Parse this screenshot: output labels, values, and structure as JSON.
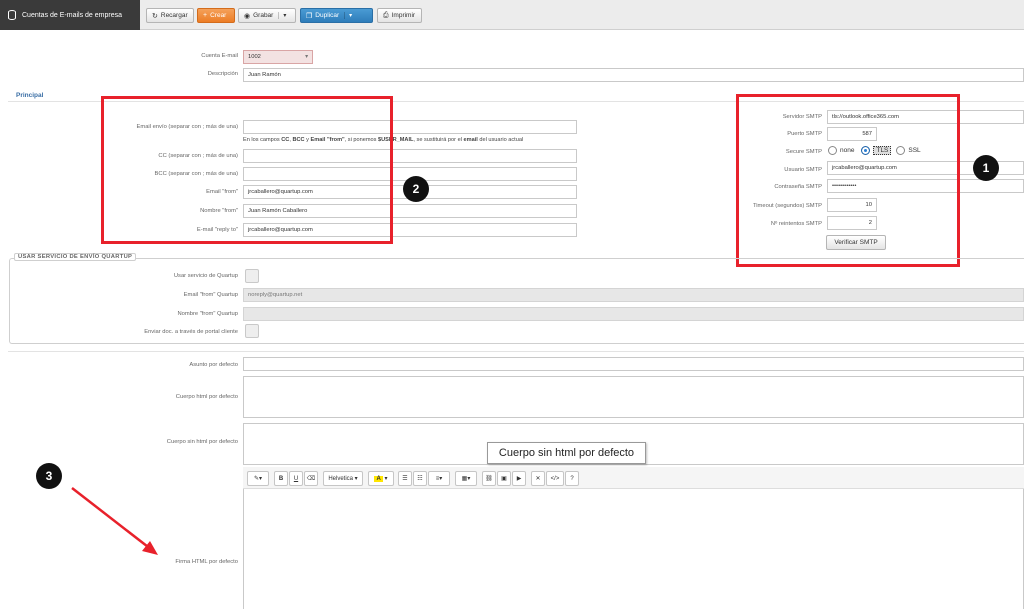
{
  "window_title": "Cuentas de E-mails de empresa",
  "toolbar": {
    "reload": "Recargar",
    "create": "Crear",
    "save": "Grabar",
    "duplicate": "Duplicar",
    "print": "Imprimir"
  },
  "account": {
    "label": "Cuenta E-mail",
    "value": "1002",
    "desc_label": "Descripción",
    "desc_value": "Juan Ramón"
  },
  "section_principal": "Principal",
  "sending": {
    "email_envio_label": "Email envío (separar con ; más de una)",
    "email_envio_value": "",
    "hint_pre": "En los campos ",
    "hint_cc": "CC",
    "hint_sep1": ", ",
    "hint_bcc": "BCC",
    "hint_and": " y ",
    "hint_from": "Email \"from\"",
    "hint_mid": ", si ponemos ",
    "hint_var": "$USER_MAIL",
    "hint_mid2": ", se sustituirá por el ",
    "hint_email": "email",
    "hint_end": " del usuario actual",
    "cc_label": "CC (separar con ; más de una)",
    "bcc_label": "BCC (separar con ; más de una)",
    "from_email_label": "Email \"from\"",
    "from_email_value": "jrcaballero@quartup.com",
    "from_name_label": "Nombre \"from\"",
    "from_name_value": "Juan Ramón Caballero",
    "reply_to_label": "E-mail \"reply to\"",
    "reply_to_value": "jrcaballero@quartup.com"
  },
  "smtp": {
    "server_label": "Servidor SMTP",
    "server_value": "tls://outlook.office365.com",
    "port_label": "Puerto SMTP",
    "port_value": "587",
    "secure_label": "Secure SMTP",
    "opt_none": "none",
    "opt_tls": "TLS",
    "opt_ssl": "SSL",
    "user_label": "Usuario SMTP",
    "user_value": "jrcaballero@quartup.com",
    "password_label": "Contraseña SMTP",
    "password_value": "••••••••••••",
    "timeout_label": "Timeout (segundos) SMTP",
    "timeout_value": "10",
    "retries_label": "Nº reintentos SMTP",
    "retries_value": "2",
    "verify_button": "Verificar SMTP"
  },
  "quartup_service": {
    "legend": "USAR SERVICIO DE ENVÍO QUARTUP",
    "use_label": "Usar servicio de Quartup",
    "from_email_label": "Email \"from\" Quartup",
    "from_email_value": "noreply@quartup.net",
    "from_name_label": "Nombre \"from\" Quartup",
    "from_name_value": "",
    "portal_label": "Enviar doc. a través de portal cliente"
  },
  "defaults": {
    "subject_label": "Asunto por defecto",
    "html_body_label": "Cuerpo html por defecto",
    "plain_body_label": "Cuerpo sin html por defecto",
    "tooltip": "Cuerpo sin html por defecto",
    "signature_label": "Firma HTML por defecto"
  },
  "editor": {
    "font_name": "Helvetica"
  },
  "badges": {
    "one": "1",
    "two": "2",
    "three": "3"
  },
  "colors": {
    "highlight_red": "#e8212b",
    "create_orange": "#ec7d26",
    "duplicate_blue": "#2e7dba",
    "section_blue": "#3a6ea5"
  }
}
